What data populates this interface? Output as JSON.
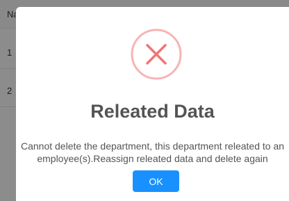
{
  "background_table": {
    "header_label": "Na",
    "rows": [
      "1",
      "2"
    ]
  },
  "dialog": {
    "icon": "error-x-icon",
    "icon_color": "#f27474",
    "title": "Releated Data",
    "message": "Cannot delete the department, this department releated to an employee(s).Reassign releated data and delete again",
    "ok_label": "OK",
    "ok_color": "#1890ff"
  }
}
